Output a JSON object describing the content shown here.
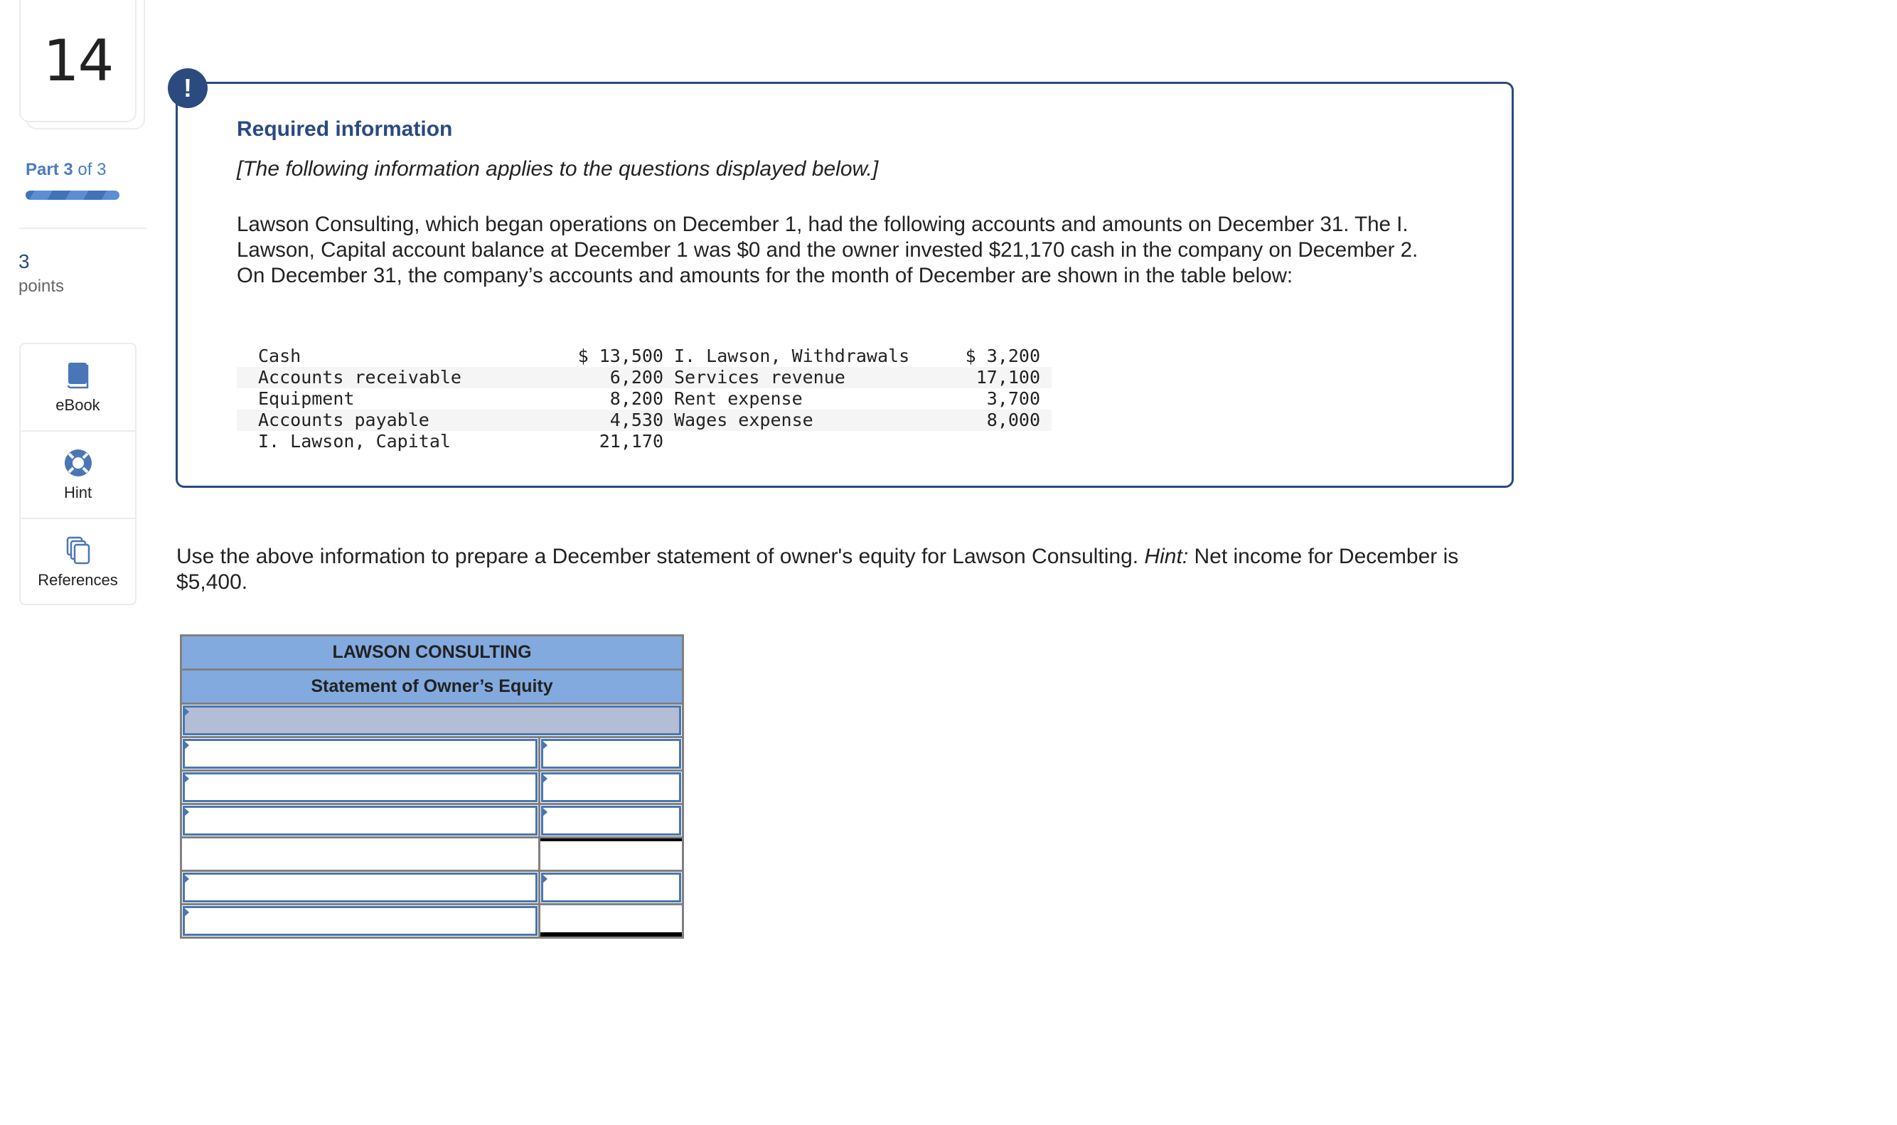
{
  "question": {
    "number": "14",
    "part_label": "Part",
    "part_current": "3",
    "part_of": "of 3",
    "progress": {
      "completed_parts": 3,
      "total_parts": 3
    },
    "points_value": "3",
    "points_label": "points"
  },
  "tools": [
    {
      "label": "eBook",
      "icon": "book-icon"
    },
    {
      "label": "Hint",
      "icon": "lifebuoy-icon"
    },
    {
      "label": "References",
      "icon": "copy-documents-icon"
    }
  ],
  "required_info": {
    "alert_glyph": "!",
    "title": "Required information",
    "subtitle": "[The following information applies to the questions displayed below.]",
    "paragraph": "Lawson Consulting, which began operations on December 1, had the following accounts and amounts on December 31. The I. Lawson, Capital account balance at December 1 was $0 and the owner invested $21,170 cash in the company on December 2. On December 31, the company’s accounts and amounts for the month of December are shown in the table below:",
    "accounts": [
      {
        "name1": "Cash",
        "amount1": "$ 13,500",
        "name2": "I. Lawson, Withdrawals",
        "amount2": "$ 3,200"
      },
      {
        "name1": "Accounts receivable",
        "amount1": "6,200",
        "name2": "Services revenue",
        "amount2": "17,100"
      },
      {
        "name1": "Equipment",
        "amount1": "8,200",
        "name2": "Rent expense",
        "amount2": "3,700"
      },
      {
        "name1": "Accounts payable",
        "amount1": "4,530",
        "name2": "Wages expense",
        "amount2": "8,000"
      },
      {
        "name1": "I. Lawson, Capital",
        "amount1": "21,170",
        "name2": "",
        "amount2": ""
      }
    ]
  },
  "instruction": {
    "text_before": "Use the above information to prepare a December statement of owner's equity for Lawson Consulting. ",
    "hint_label": "Hint:",
    "text_after": " Net income for December is $5,400."
  },
  "statement": {
    "company": "LAWSON CONSULTING",
    "title": "Statement of Owner’s Equity",
    "date_value": "",
    "rows": [
      {
        "label": "",
        "amount": ""
      },
      {
        "label": "",
        "amount": ""
      },
      {
        "label": "",
        "amount": ""
      },
      {
        "label": "",
        "amount": ""
      },
      {
        "label": "",
        "amount": ""
      },
      {
        "label": "",
        "amount": ""
      }
    ]
  },
  "colors": {
    "brand_dark_blue": "#2a4a80",
    "accent_blue": "#4a7bc4",
    "table_header": "#82aadf",
    "date_row": "#b3bed6",
    "input_border": "#4a76b0"
  }
}
